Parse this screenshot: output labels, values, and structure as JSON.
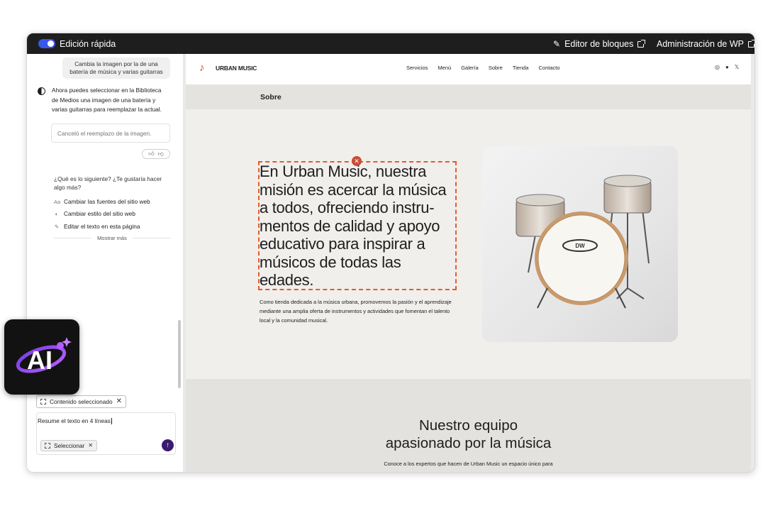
{
  "topbar": {
    "quick_edit_label": "Edición rápida",
    "block_editor_label": "Editor de bloques",
    "wp_admin_label": "Administración de WP"
  },
  "chat": {
    "user_message": "Cambia la imagen por la de una batería de música y varias guitarras",
    "assistant_message": "Ahora puedes seleccionar en la Biblioteca de Medios una imagen de una batería y varias guitarras para reemplazar la actual.",
    "status_message": "Canceló el reemplazo de la imagen.",
    "next_question": "¿Qué es lo siguiente? ¿Te gustaría hacer algo más?",
    "suggestions": [
      {
        "icon": "Aa",
        "label": "Cambiar las fuentes del sitio web"
      },
      {
        "icon": "◐",
        "label": "Cambiar estilo del sitio web"
      },
      {
        "icon": "✎",
        "label": "Editar el texto en esta página"
      }
    ],
    "show_more": "Mostrar más",
    "context_chip": "Contenido seleccionado",
    "prompt_value": "Resume el texto en 4 líneas",
    "select_chip": "Seleccionar"
  },
  "site": {
    "brand": "URBAN MUSIC",
    "nav": [
      "Servicios",
      "Menú",
      "Galería",
      "Sobre",
      "Tienda",
      "Contacto"
    ],
    "socials": [
      "◎",
      "●",
      "𝕏"
    ],
    "section_label": "Sobre",
    "heading": "En Urban Music, nuestra misión es acercar la música a todos, ofreciendo instru-mentos de calidad y apoyo educativo para inspirar a músicos de todas las edades.",
    "paragraph": "Como tienda dedicada a la música urbana, promovemos la pasión y el aprendizaje mediante una amplia oferta de instrumentos y actividades que fomentan el talento local y la comunidad musical.",
    "team_title_1": "Nuestro equipo",
    "team_title_2": "apasionado por la música",
    "team_subtitle": "Conoce a los expertos que hacen de Urban Music un espacio único para"
  },
  "ai_badge": {
    "label": "AI"
  },
  "colors": {
    "accent": "#3858e9",
    "send_button": "#3b1b6e",
    "selection_outline": "#e35b2e",
    "brand_note": "#d14b2a"
  }
}
